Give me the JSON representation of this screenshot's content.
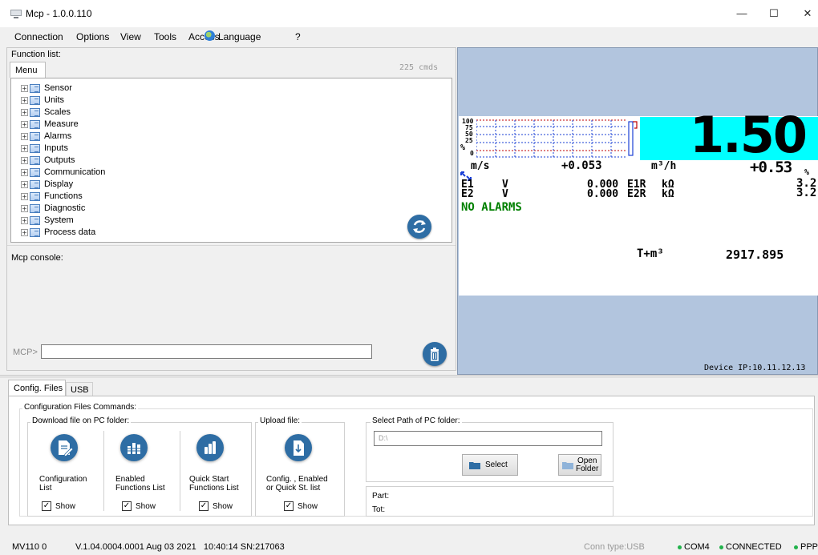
{
  "window": {
    "title": "Mcp - 1.0.0.110",
    "minimize_icon": "minimize-icon",
    "maximize_icon": "maximize-icon",
    "close_icon": "close-icon"
  },
  "menubar": {
    "items": [
      "Connection",
      "Options",
      "View",
      "Tools",
      "Access",
      "Language",
      "?"
    ]
  },
  "function_list": {
    "label": "Function list:",
    "tab": "Menu",
    "count": "225 cmds",
    "items": [
      "Sensor",
      "Units",
      "Scales",
      "Measure",
      "Alarms",
      "Inputs",
      "Outputs",
      "Communication",
      "Display",
      "Functions",
      "Diagnostic",
      "System",
      "Process data"
    ]
  },
  "console": {
    "label": "Mcp console:",
    "prompt": "MCP>",
    "input_value": ""
  },
  "device": {
    "bar_scale": [
      "100",
      "75",
      "50",
      "25",
      "0"
    ],
    "bar_unit": "%",
    "big_value": "1.50",
    "unit_velocity": "m/s",
    "flow_value": "+0.053",
    "flow_unit": "m³/h",
    "percent_value": "+0.53",
    "percent_unit": "%",
    "e1_label": "E1",
    "e1_unit": "V",
    "e1_value": "0.000",
    "e1r_label": "E1R",
    "e1r_unit": "kΩ",
    "e1r_value": "3.2",
    "e2_label": "E2",
    "e2_unit": "V",
    "e2_value": "0.000",
    "e2r_label": "E2R",
    "e2r_unit": "kΩ",
    "e2r_value": "3.2",
    "alarms": "NO ALARMS",
    "totalizer_label": "T+m³",
    "totalizer_value": "2917.895",
    "ip_label": "Device IP:10.11.12.13",
    "colors": {
      "highlight": "#00ffff",
      "display_bg": "#b2c5de",
      "alarm": "#008000"
    }
  },
  "bottom": {
    "tabs": [
      "Config. Files",
      "USB"
    ],
    "group_title": "Configuration Files Commands:",
    "download_label": "Download file on PC folder:",
    "upload_label": "Upload file:",
    "path_label": "Select Path of PC folder:",
    "path_value": "D:\\",
    "buttons": [
      {
        "caption_1": "Configuration",
        "caption_2": "List",
        "show": "Show"
      },
      {
        "caption_1": "Enabled",
        "caption_2": "Functions List",
        "show": "Show"
      },
      {
        "caption_1": "Quick Start",
        "caption_2": "Functions List",
        "show": "Show"
      },
      {
        "caption_1": "Config. , Enabled",
        "caption_2": "or Quick St. list",
        "show": "Show"
      }
    ],
    "select_button": "Select",
    "open_button_1": "Open",
    "open_button_2": "Folder",
    "part_label": "Part:",
    "tot_label": "Tot:"
  },
  "status": {
    "model": "MV110 0",
    "version": "V.1.04.0004.0001 Aug 03 2021   10:40:14 SN:217063",
    "conn_type": "Conn type:USB",
    "port": "COM4",
    "connection": "CONNECTED",
    "protocol": "PPP",
    "colors": {
      "ok": "#21b24b",
      "muted": "#9a9a9a"
    }
  }
}
